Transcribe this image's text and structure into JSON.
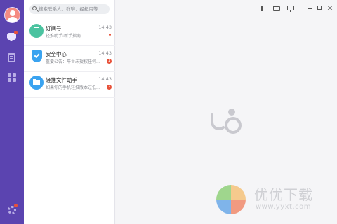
{
  "search": {
    "placeholder": "搜索联系人、群聊、经纪用等"
  },
  "chats": [
    {
      "name": "订阅号",
      "preview": "轻推助手:新手指南",
      "time": "14:43",
      "badge": ""
    },
    {
      "name": "安全中心",
      "preview": "重要公告：平台未授权任何...",
      "time": "14:43",
      "badge": "1"
    },
    {
      "name": "轻推文件助手",
      "preview": "如果你的手机轻推版本过低...",
      "time": "14:43",
      "badge": "2"
    }
  ],
  "rail": {
    "icons": [
      "avatar",
      "chat-icon",
      "contacts-icon",
      "apps-icon",
      "settings-icon"
    ]
  },
  "toolbar": {
    "icons": [
      "plus-icon",
      "folder-icon",
      "screen-icon",
      "minimize-icon",
      "maximize-icon",
      "close-icon"
    ]
  },
  "watermark": {
    "text": "优优下载",
    "url": "www.yyxt.com"
  },
  "colors": {
    "rail": "#5b44b0",
    "accent_red": "#e8523a",
    "subscribe_icon": "#4bc3a0",
    "blue_icon": "#3aa3f0"
  }
}
